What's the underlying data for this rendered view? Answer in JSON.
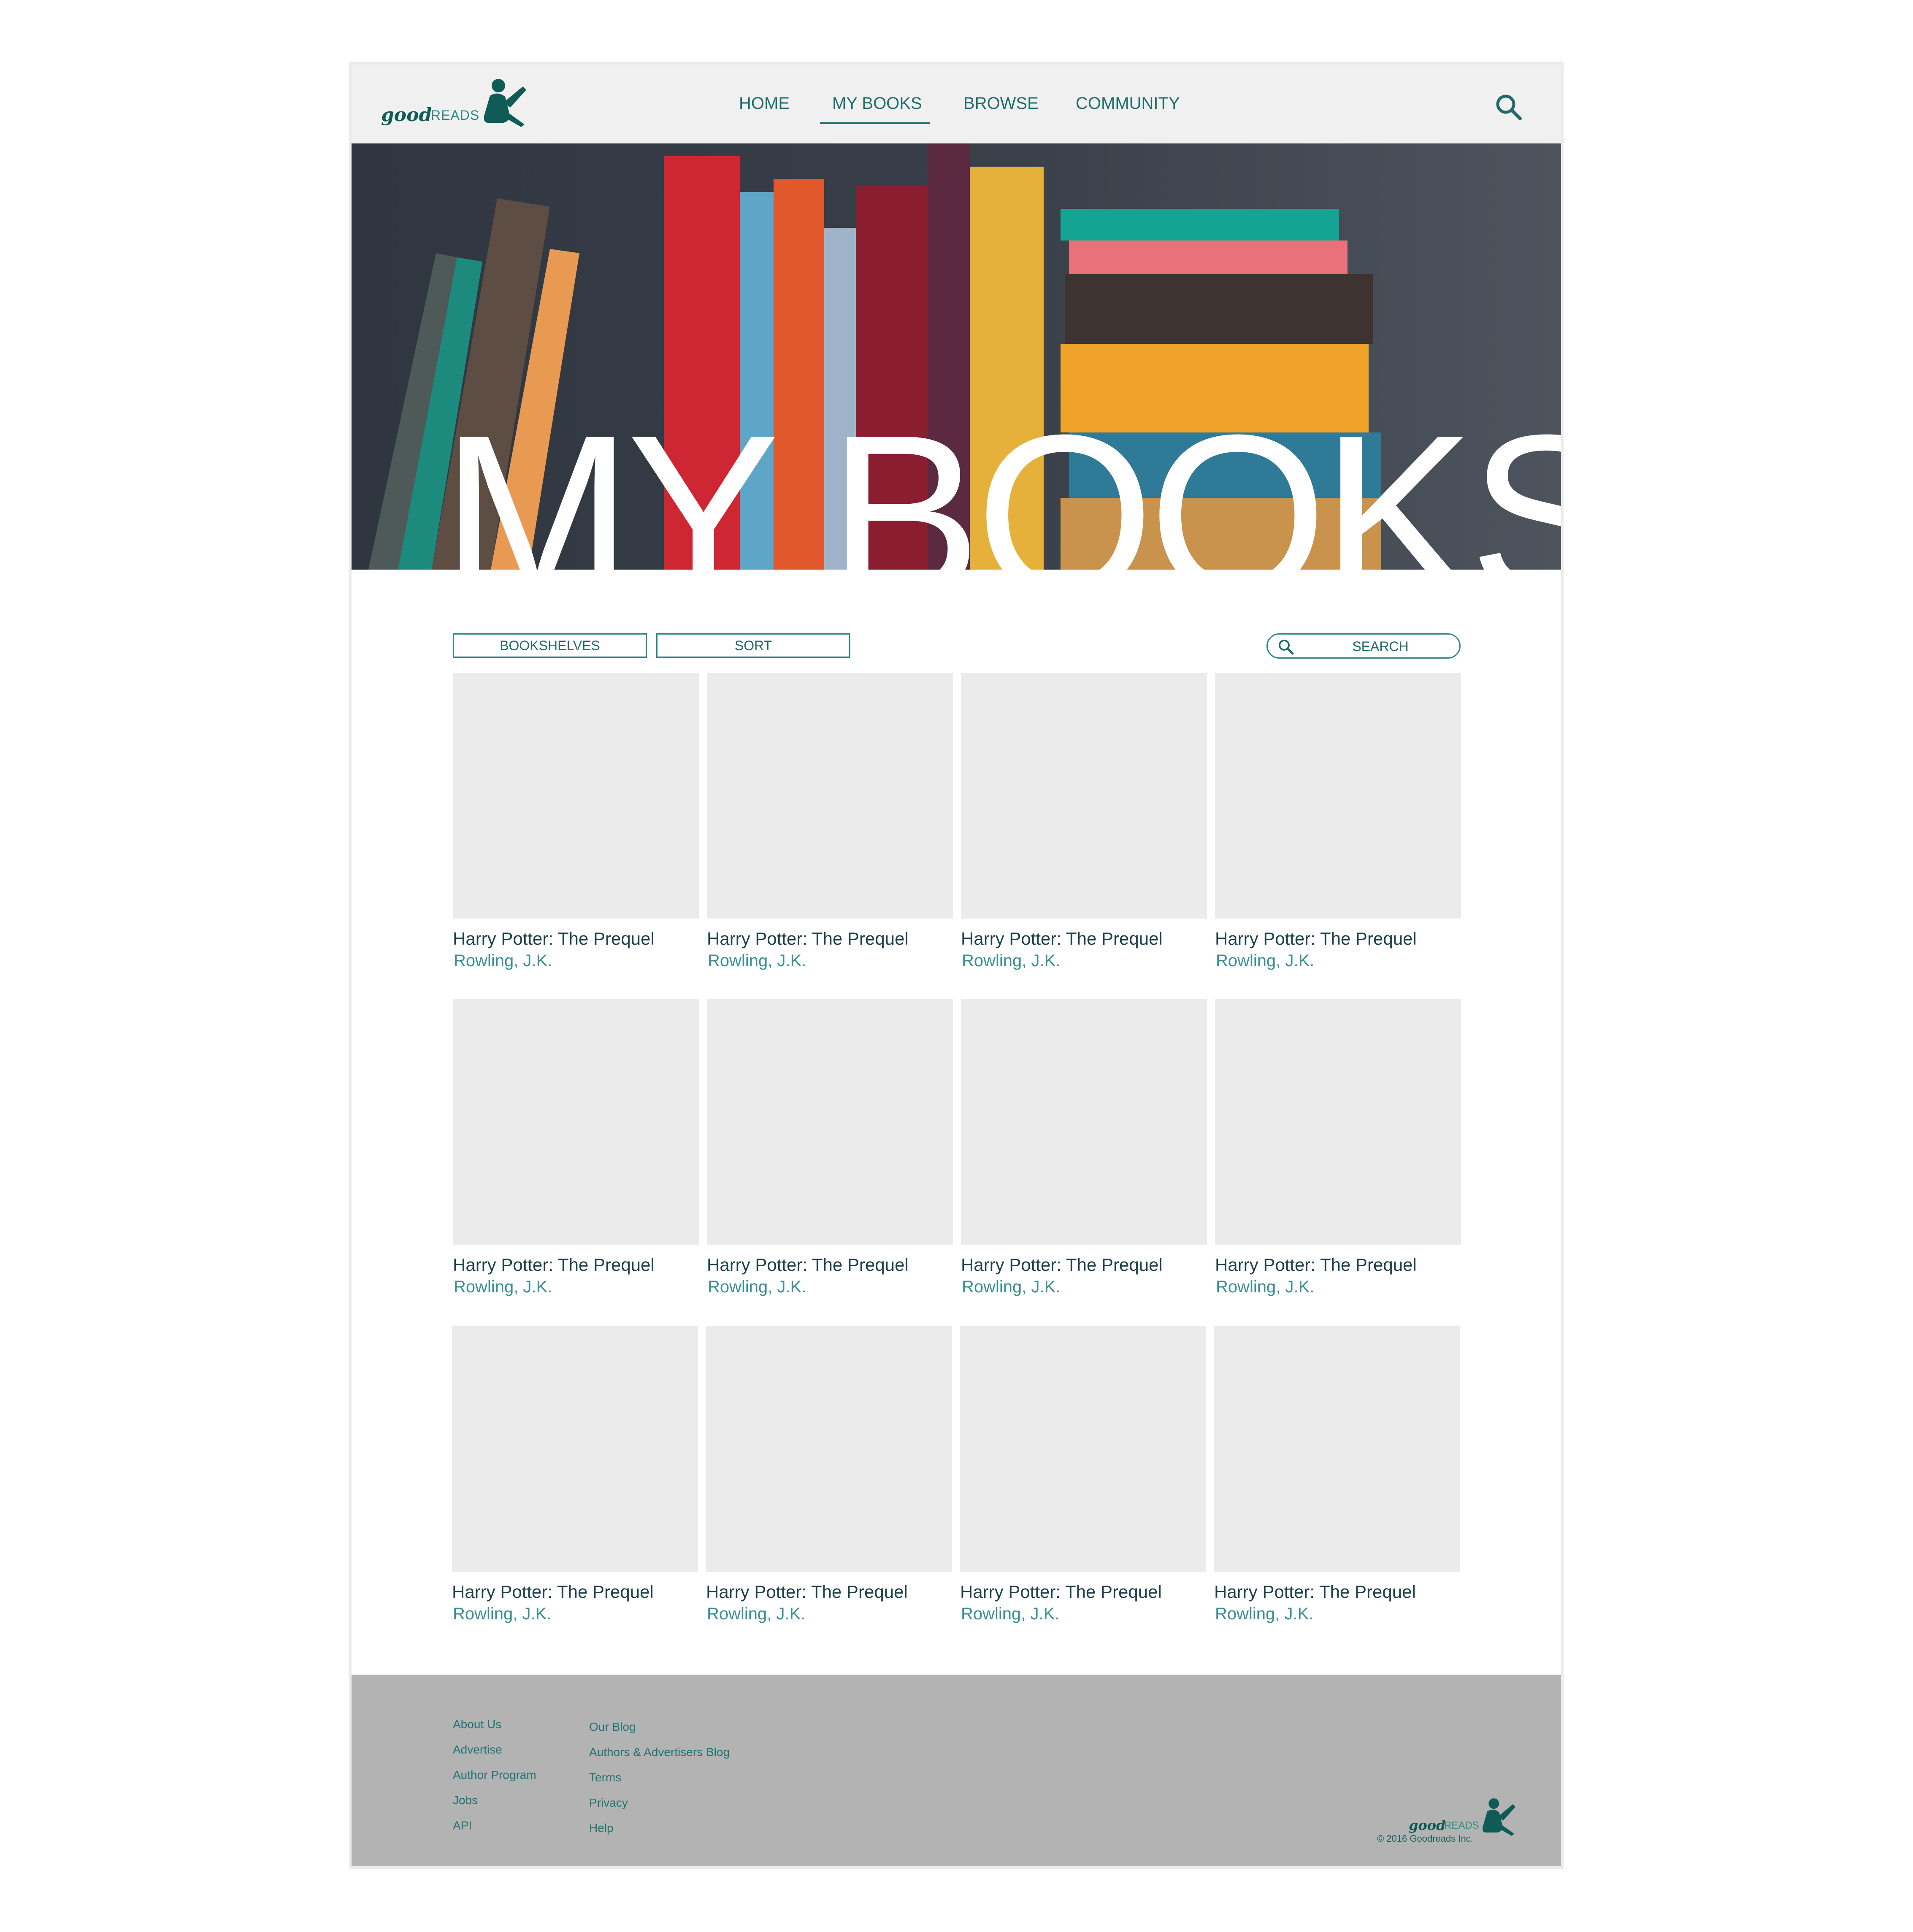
{
  "brand": {
    "logo_good": "good",
    "logo_reads": "READS",
    "accent_color": "#1f6b6b"
  },
  "nav": {
    "items": [
      {
        "label": "HOME"
      },
      {
        "label": "MY BOOKS",
        "active": true
      },
      {
        "label": "BROWSE"
      },
      {
        "label": "COMMUNITY"
      }
    ],
    "search_icon": "search-icon"
  },
  "hero": {
    "title": "MY BOOKS"
  },
  "toolbar": {
    "bookshelves_label": "BOOKSHELVES",
    "sort_label": "SORT",
    "search_label": "SEARCH"
  },
  "books": [
    {
      "title": "Harry Potter: The Prequel",
      "author": "Rowling, J.K."
    },
    {
      "title": "Harry Potter: The Prequel",
      "author": "Rowling, J.K."
    },
    {
      "title": "Harry Potter: The Prequel",
      "author": "Rowling, J.K."
    },
    {
      "title": "Harry Potter: The Prequel",
      "author": "Rowling, J.K."
    },
    {
      "title": "Harry Potter: The Prequel",
      "author": "Rowling, J.K."
    },
    {
      "title": "Harry Potter: The Prequel",
      "author": "Rowling, J.K."
    },
    {
      "title": "Harry Potter: The Prequel",
      "author": "Rowling, J.K."
    },
    {
      "title": "Harry Potter: The Prequel",
      "author": "Rowling, J.K."
    },
    {
      "title": "Harry Potter: The Prequel",
      "author": "Rowling, J.K."
    },
    {
      "title": "Harry Potter: The Prequel",
      "author": "Rowling, J.K."
    },
    {
      "title": "Harry Potter: The Prequel",
      "author": "Rowling, J.K."
    },
    {
      "title": "Harry Potter: The Prequel",
      "author": "Rowling, J.K."
    }
  ],
  "footer": {
    "col1": [
      "About Us",
      "Advertise",
      "Author Program",
      "Jobs",
      "API"
    ],
    "col2": [
      "Our Blog",
      "Authors & Advertisers Blog",
      "Terms",
      "Privacy",
      "Help"
    ],
    "copyright": "© 2016 Goodreads Inc."
  }
}
